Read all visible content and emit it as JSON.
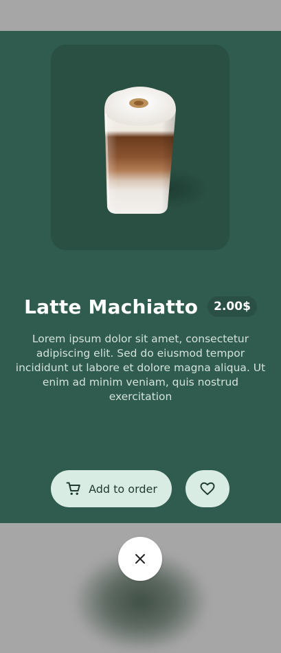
{
  "product": {
    "name": "Latte Machiatto",
    "price": "2.00$",
    "description": "Lorem ipsum dolor sit amet, consectetur adipiscing elit. Sed do eiusmod tempor incididunt ut labore et dolore magna aliqua. Ut enim ad minim veniam, quis nostrud exercitation",
    "image_icon": "latte-glass-image"
  },
  "actions": {
    "add_label": "Add to order",
    "add_icon": "cart-icon",
    "favorite_icon": "heart-icon",
    "close_icon": "close-icon"
  },
  "colors": {
    "card_background": "#2f5c4e",
    "image_background": "#2a5043",
    "button_background": "#d8ece3",
    "overlay_background": "#a6a6a6"
  }
}
